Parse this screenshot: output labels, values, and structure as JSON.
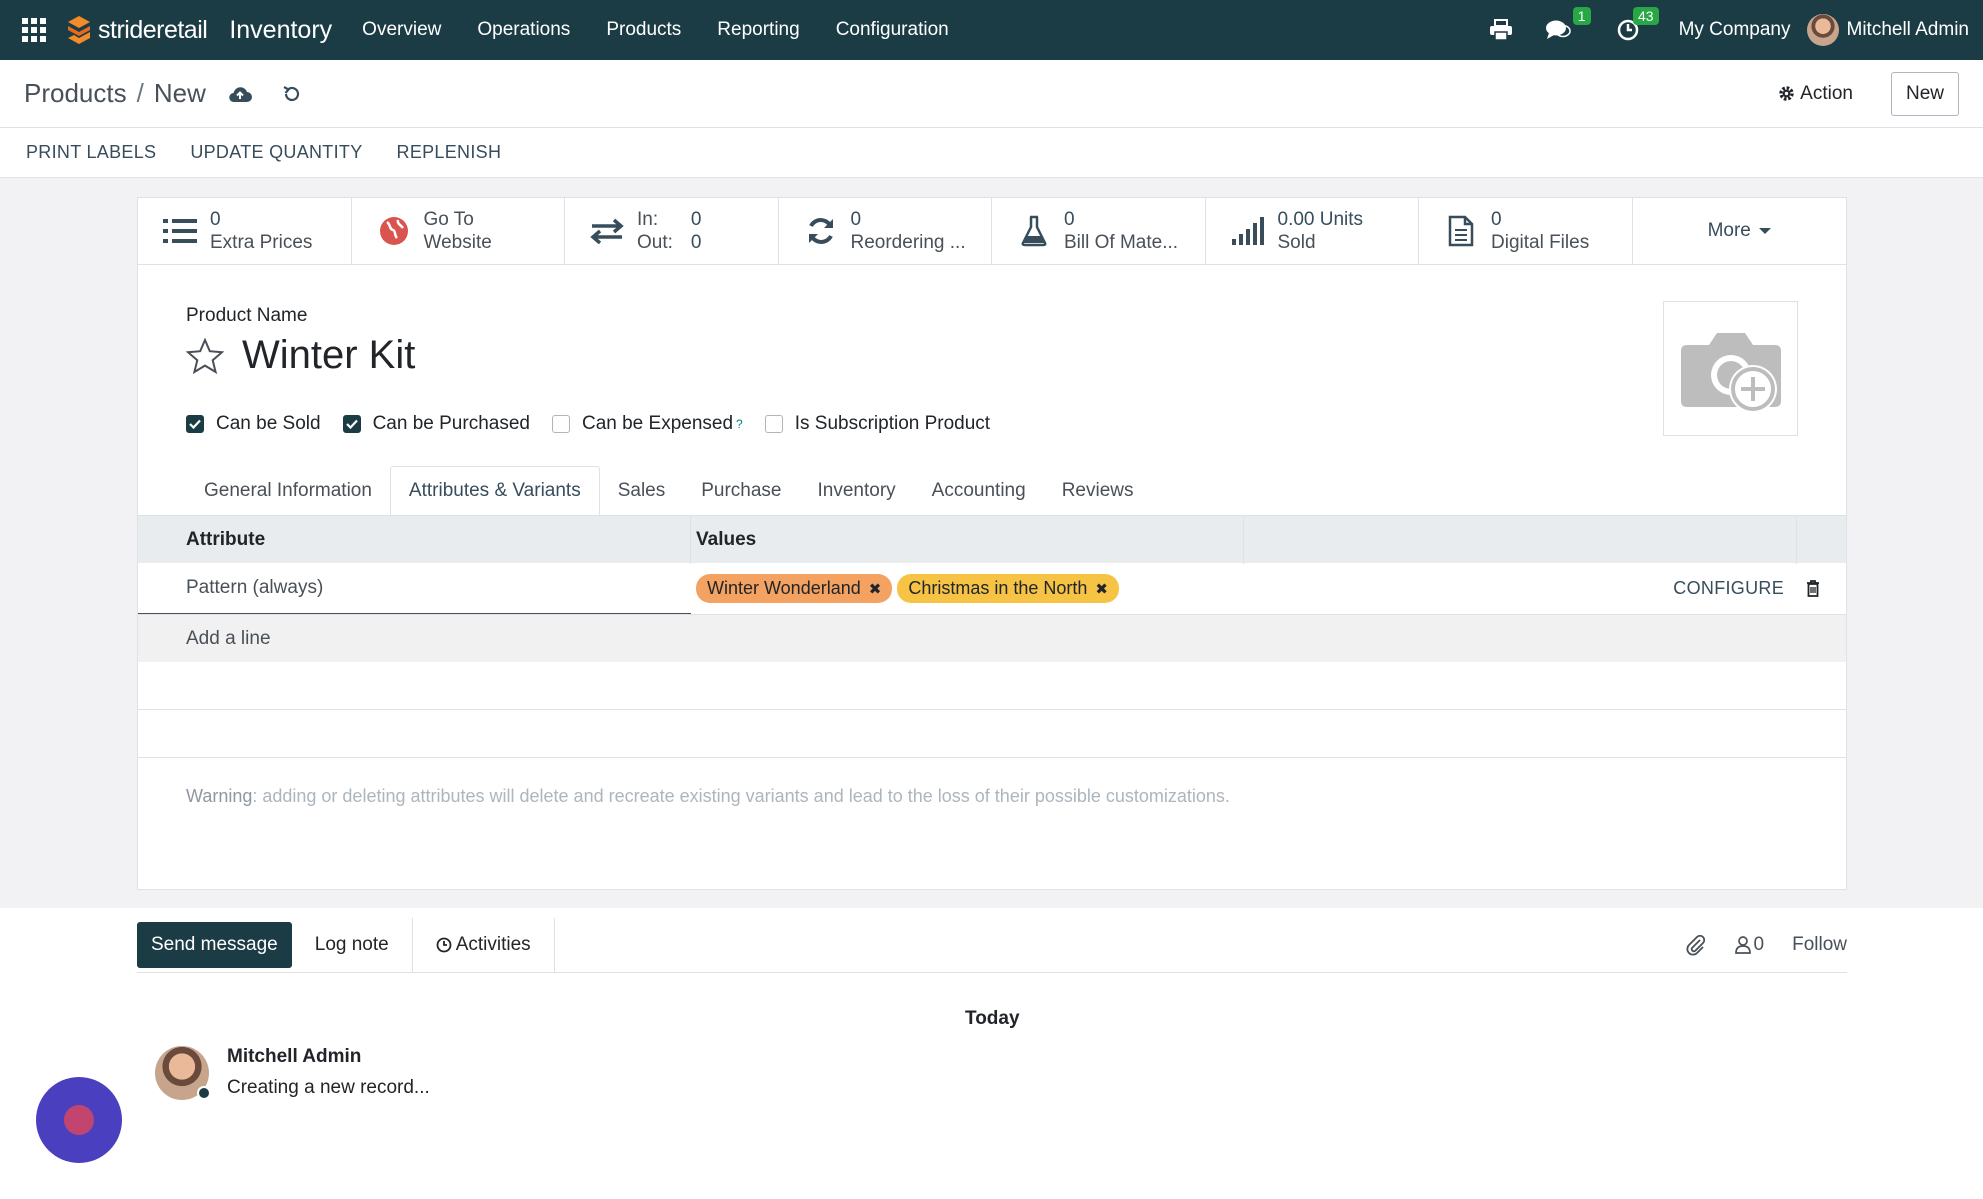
{
  "navbar": {
    "brand": "strideretail",
    "app_name": "Inventory",
    "menu": [
      "Overview",
      "Operations",
      "Products",
      "Reporting",
      "Configuration"
    ],
    "messages_badge": "1",
    "activities_badge": "43",
    "company": "My Company",
    "user": "Mitchell Admin",
    "bg_color": "#1c3c45"
  },
  "control_panel": {
    "breadcrumb_parent": "Products",
    "breadcrumb_sep": "/",
    "breadcrumb_current": "New",
    "action_label": "Action",
    "new_label": "New"
  },
  "statusbar": {
    "buttons": [
      "PRINT LABELS",
      "UPDATE QUANTITY",
      "REPLENISH"
    ]
  },
  "smart_buttons": {
    "extra_prices": {
      "value": "0",
      "label": "Extra Prices"
    },
    "website": {
      "line1": "Go To",
      "line2": "Website"
    },
    "in_out": {
      "in_label": "In:",
      "in_value": "0",
      "out_label": "Out:",
      "out_value": "0"
    },
    "reordering": {
      "value": "0",
      "label": "Reordering ..."
    },
    "bom": {
      "value": "0",
      "label": "Bill Of Mate..."
    },
    "sold": {
      "value": "0.00 Units",
      "label": "Sold"
    },
    "digital": {
      "value": "0",
      "label": "Digital Files"
    },
    "more": "More"
  },
  "product": {
    "name_label": "Product Name",
    "name": "Winter Kit",
    "checkboxes": [
      {
        "label": "Can be Sold",
        "checked": true
      },
      {
        "label": "Can be Purchased",
        "checked": true
      },
      {
        "label": "Can be Expensed",
        "checked": false,
        "help": "?"
      },
      {
        "label": "Is Subscription Product",
        "checked": false
      }
    ]
  },
  "tabs": [
    "General Information",
    "Attributes & Variants",
    "Sales",
    "Purchase",
    "Inventory",
    "Accounting",
    "Reviews"
  ],
  "active_tab": "Attributes & Variants",
  "attributes_table": {
    "headers": {
      "attribute": "Attribute",
      "values": "Values"
    },
    "rows": [
      {
        "attribute": "Pattern (always)",
        "values": [
          {
            "label": "Winter Wonderland",
            "color": "#f4a261"
          },
          {
            "label": "Christmas in the North",
            "color": "#f6c344"
          }
        ],
        "configure": "CONFIGURE"
      }
    ],
    "add_line": "Add a line"
  },
  "warning": {
    "label": "Warning",
    "text": ": adding or deleting attributes will delete and recreate existing variants and lead to the loss of their possible customizations."
  },
  "chatter": {
    "send_message": "Send message",
    "log_note": "Log note",
    "activities": "Activities",
    "followers_count": "0",
    "follow": "Follow",
    "date_separator": "Today",
    "message": {
      "author": "Mitchell Admin",
      "body": "Creating a new record..."
    }
  }
}
